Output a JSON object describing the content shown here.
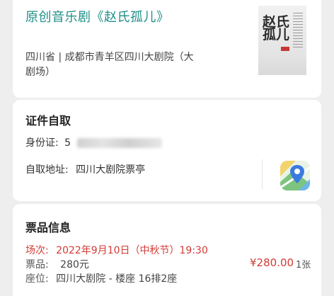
{
  "show": {
    "title": "原创音乐剧《赵氏孤儿》",
    "venue": "四川省 | 成都市青羊区四川大剧院（大剧场）",
    "poster_text": "赵氏孤儿"
  },
  "pickup": {
    "section_title": "证件自取",
    "id_label": "身份证:",
    "id_value_visible": "5",
    "address_label": "自取地址:",
    "address_value": "四川大剧院票亭"
  },
  "ticket": {
    "section_title": "票品信息",
    "session_label": "场次:",
    "session_value": "2022年9月10日（中秋节）19:30",
    "item_label": "票品:",
    "item_value": "280元",
    "seat_label": "座位:",
    "seat_value": "四川大剧院 - 楼座 16排2座",
    "price": "¥280.00",
    "quantity": "1张"
  },
  "colors": {
    "title": "#1f8f88",
    "accent_red": "#d23b35"
  }
}
